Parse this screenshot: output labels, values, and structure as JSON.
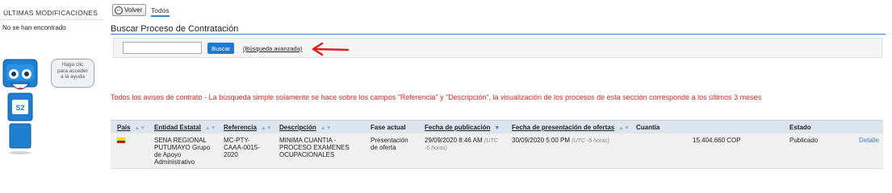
{
  "sidebar": {
    "title": "ÚLTIMAS MODIFICACIONES",
    "empty_text": "No se han encontrado",
    "help_bubble": [
      "Haga clic",
      "para acceder",
      "a la ayuda"
    ],
    "robot_badge": "S2"
  },
  "toolbar": {
    "back_label": "Volver",
    "tab_label": "Todos"
  },
  "page_title": "Buscar Proceso de Contratación",
  "search": {
    "value": "",
    "placeholder": "",
    "button_label": "Buscar",
    "advanced_link": "(Búsqueda avanzada)"
  },
  "notice": "Todos los avisos de contrato - La búsqueda simple solamente se hace sobre los campos \"Referencia\" y \"Descripción\", la visualización de los procesos de esta sección corresponde a los últimos 3 meses",
  "table": {
    "headers": {
      "pais": "País",
      "entidad": "Entidad Estatal",
      "referencia": "Referencia",
      "descripcion": "Descripción",
      "fase": "Fase actual",
      "fecha_pub": "Fecha de publicación",
      "fecha_pres": "Fecha de presentación de ofertas",
      "cuantia": "Cuantía",
      "estado": "Estado"
    },
    "rows": [
      {
        "entidad": [
          "SENA REGIONAL",
          "PUTUMAYO Grupo",
          "de Apoyo",
          "Administrativo"
        ],
        "referencia": [
          "MC-PTY-",
          "CAAA-0015-",
          "2020"
        ],
        "descripcion": [
          "MINIMA CUANTIA -",
          "PROCESO EXAMENES",
          "OCUPACIONALES"
        ],
        "fase": [
          "Presentación",
          "de oferta"
        ],
        "fecha_pub": "29/09/2020 8:46 AM",
        "fecha_pub_tz_a": "(UTC",
        "fecha_pub_tz_b": "-5 horas)",
        "fecha_pres": "30/09/2020 5:00 PM",
        "fecha_pres_tz": "(UTC -5 horas)",
        "cuantia": "15.404.660 COP",
        "estado": "Publicado",
        "detalle": "Detalle"
      }
    ]
  },
  "colors": {
    "accent": "#3a7fc1",
    "button": "#1a7bd6",
    "notice": "#e02424",
    "arrow": "#e01e1e"
  }
}
